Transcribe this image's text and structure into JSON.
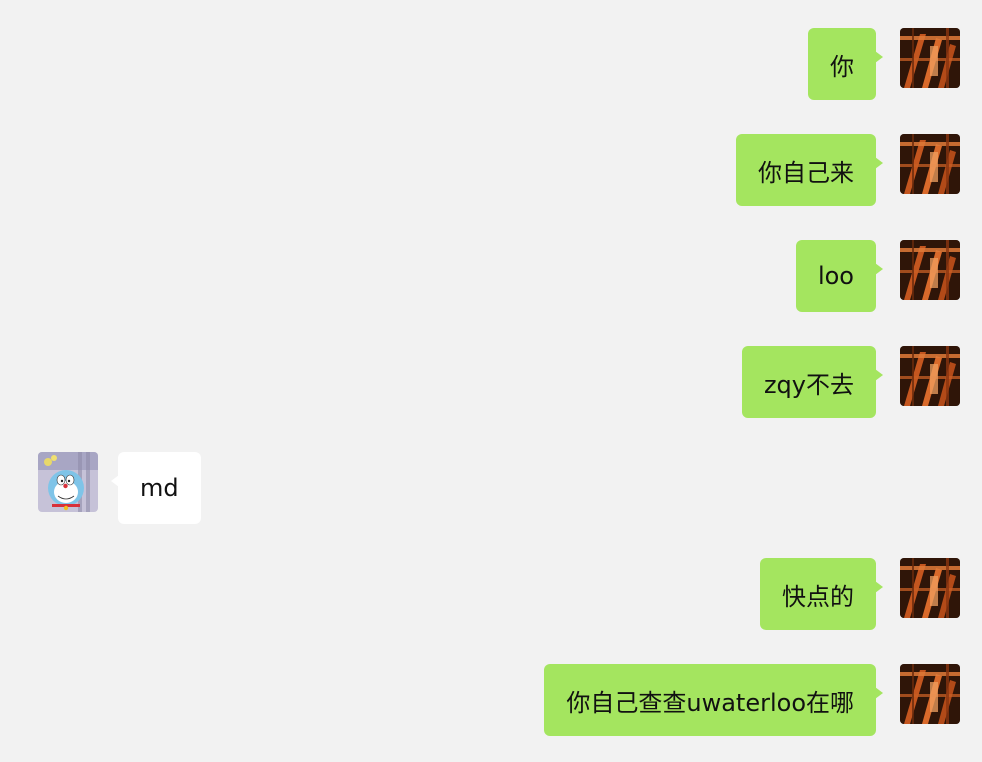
{
  "messages": [
    {
      "sender": "me",
      "text": "你"
    },
    {
      "sender": "me",
      "text": "你自己来"
    },
    {
      "sender": "me",
      "text": "loo"
    },
    {
      "sender": "me",
      "text": "zqy不去"
    },
    {
      "sender": "them",
      "text": "md"
    },
    {
      "sender": "me",
      "text": "快点的"
    },
    {
      "sender": "me",
      "text": "你自己查查uwaterloo在哪"
    }
  ],
  "colors": {
    "background": "#f2f2f2",
    "my_bubble": "#a4e55f",
    "their_bubble": "#ffffff"
  },
  "icons": {
    "my_avatar": "dark-orange-photo-avatar",
    "their_avatar": "doraemon-cartoon-avatar"
  }
}
